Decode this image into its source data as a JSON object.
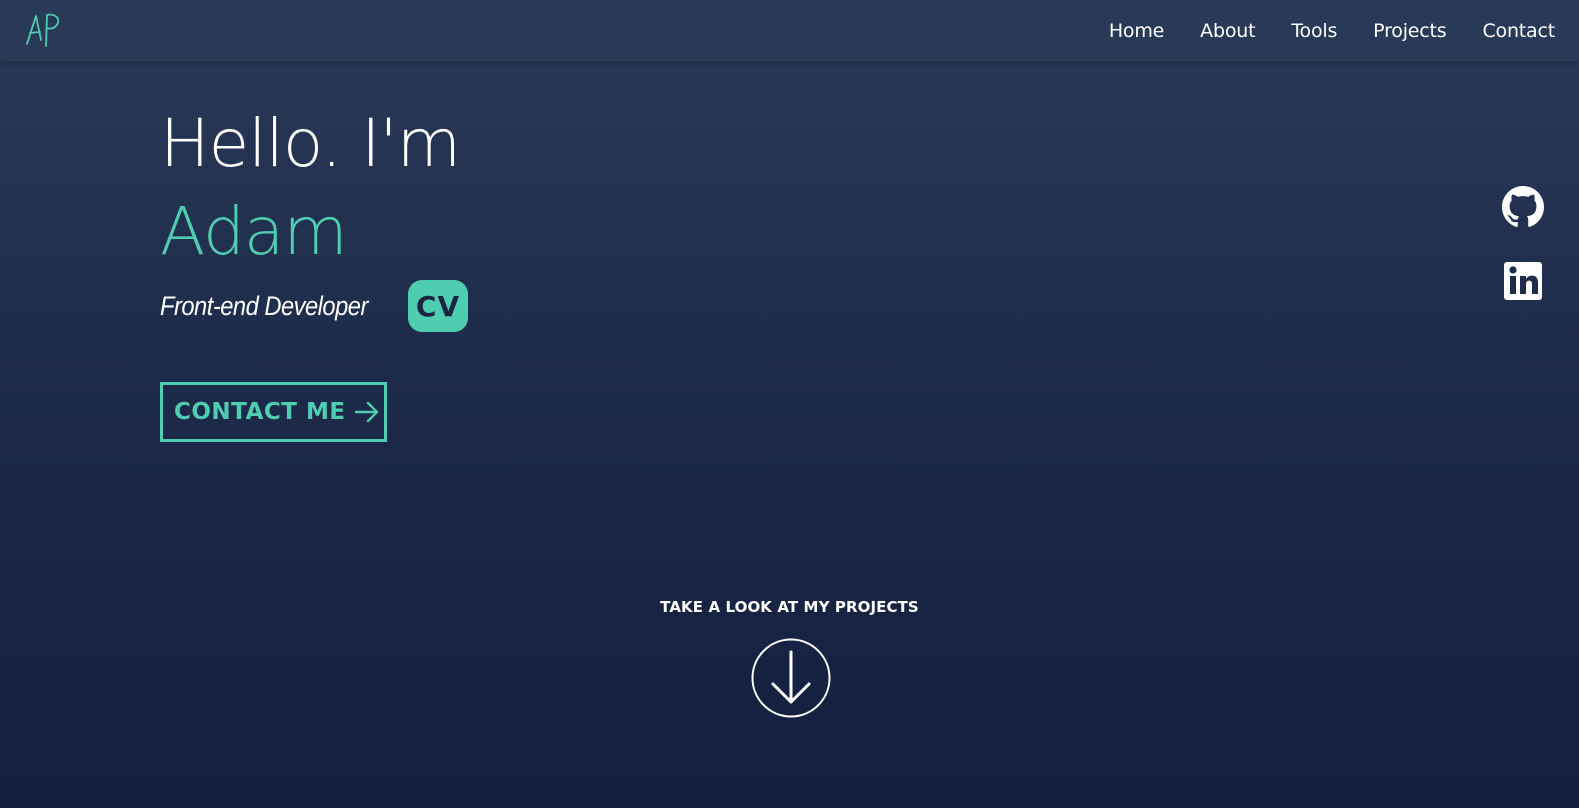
{
  "brand": {
    "logo_text": "AP",
    "logo_color": "#4ecdb0"
  },
  "nav": {
    "items": [
      {
        "label": "Home"
      },
      {
        "label": "About"
      },
      {
        "label": "Tools"
      },
      {
        "label": "Projects"
      },
      {
        "label": "Contact"
      }
    ]
  },
  "hero": {
    "greeting": "Hello. I'm",
    "name": "Adam",
    "role": "Front-end Developer",
    "cv_label": "CV",
    "contact_label": "CONTACT ME"
  },
  "social": {
    "icons": [
      "github-icon",
      "linkedin-icon"
    ]
  },
  "scroll": {
    "label": "TAKE A LOOK AT MY PROJECTS"
  },
  "colors": {
    "accent": "#4ecdb0",
    "background_top": "#2a3a58",
    "background_bottom": "#141e40",
    "text": "#ffffff"
  }
}
